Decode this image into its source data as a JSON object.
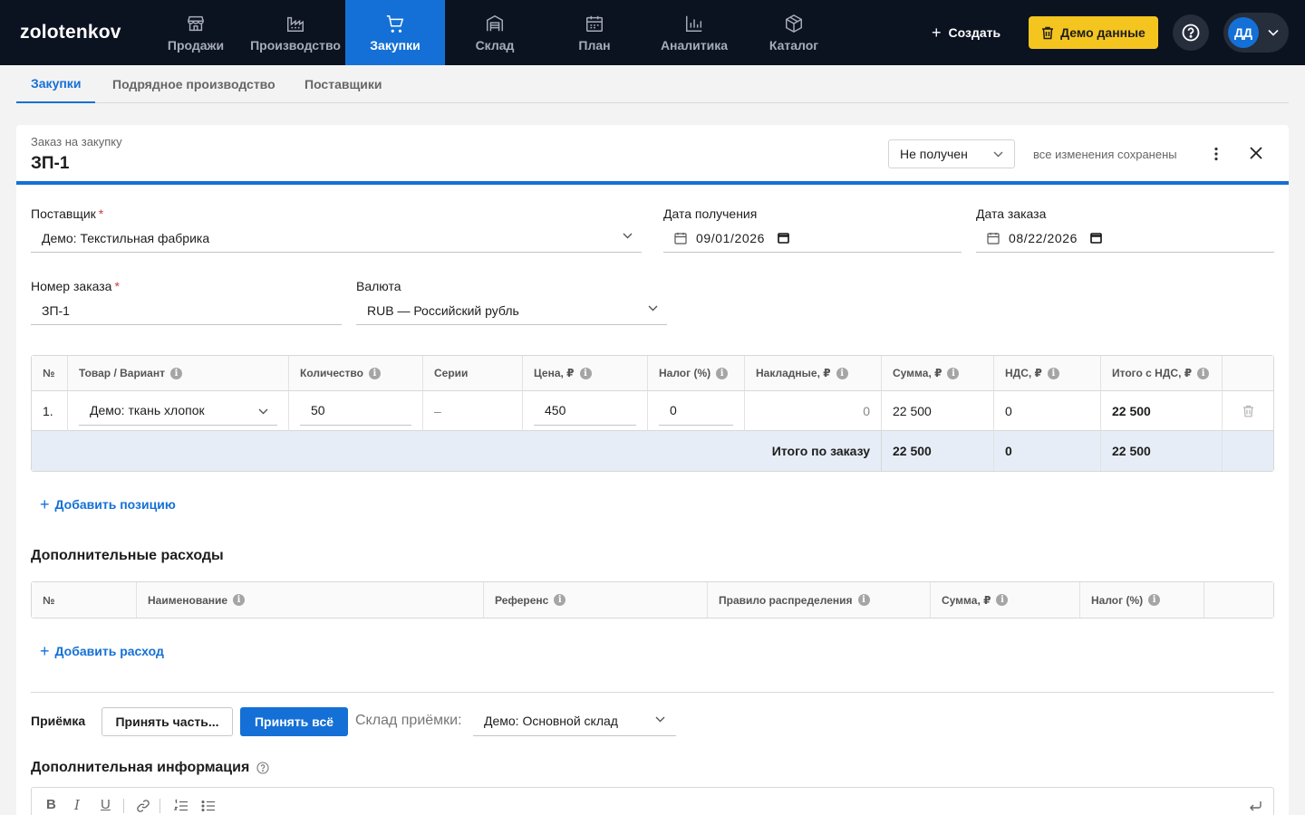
{
  "app": {
    "logo": "zolotenkov",
    "nav": [
      {
        "label": "Продажи",
        "icon": "store-icon"
      },
      {
        "label": "Производство",
        "icon": "factory-icon"
      },
      {
        "label": "Закупки",
        "icon": "cart-icon"
      },
      {
        "label": "Склад",
        "icon": "warehouse-icon"
      },
      {
        "label": "План",
        "icon": "calendar-icon"
      },
      {
        "label": "Аналитика",
        "icon": "bar-chart-icon"
      },
      {
        "label": "Каталог",
        "icon": "box-icon"
      }
    ],
    "create_label": "Создать",
    "demo_label": "Демо данные",
    "user_initials": "ДД",
    "accent": "#1470d6",
    "demo_color": "#f5c51f"
  },
  "subtabs": [
    "Закупки",
    "Подрядное производство",
    "Поставщики"
  ],
  "order": {
    "kind": "Заказ на закупку",
    "number_title": "ЗП-1",
    "status": "Не получен",
    "saved_note": "все изменения сохранены",
    "supplier_label": "Поставщик",
    "supplier_value": "Демо: Текстильная фабрика",
    "receive_date_label": "Дата получения",
    "receive_date_value": "09/01/2026",
    "order_date_label": "Дата заказа",
    "order_date_value": "08/22/2026",
    "order_number_label": "Номер заказа",
    "order_number_value": "ЗП-1",
    "currency_label": "Валюта",
    "currency_value": "RUB — Российский рубль"
  },
  "items_table": {
    "headers": [
      "№",
      "Товар / Вариант",
      "Количество",
      "Серии",
      "Цена, ₽",
      "Налог (%)",
      "Накладные, ₽",
      "Сумма, ₽",
      "НДС, ₽",
      "Итого с НДС, ₽"
    ],
    "rows": [
      {
        "num": "1.",
        "product": "Демо: ткань хлопок",
        "qty": "50",
        "series": "–",
        "price": "450",
        "tax": "0",
        "overhead": "0",
        "sum": "22 500",
        "vat": "0",
        "total": "22 500"
      }
    ],
    "footer": {
      "label": "Итого по заказу",
      "sum": "22 500",
      "vat": "0",
      "total": "22 500"
    },
    "add_label": "Добавить позицию"
  },
  "extra_costs": {
    "title": "Дополнительные расходы",
    "headers": [
      "№",
      "Наименование",
      "Референс",
      "Правило распределения",
      "Сумма, ₽",
      "Налог (%)"
    ],
    "add_label": "Добавить расход"
  },
  "receipt": {
    "label": "Приёмка",
    "partial_label": "Принять часть...",
    "all_label": "Принять всё",
    "warehouse_label": "Склад приёмки:",
    "warehouse_value": "Демо: Основной склад"
  },
  "additional_info": {
    "title": "Дополнительная информация"
  }
}
